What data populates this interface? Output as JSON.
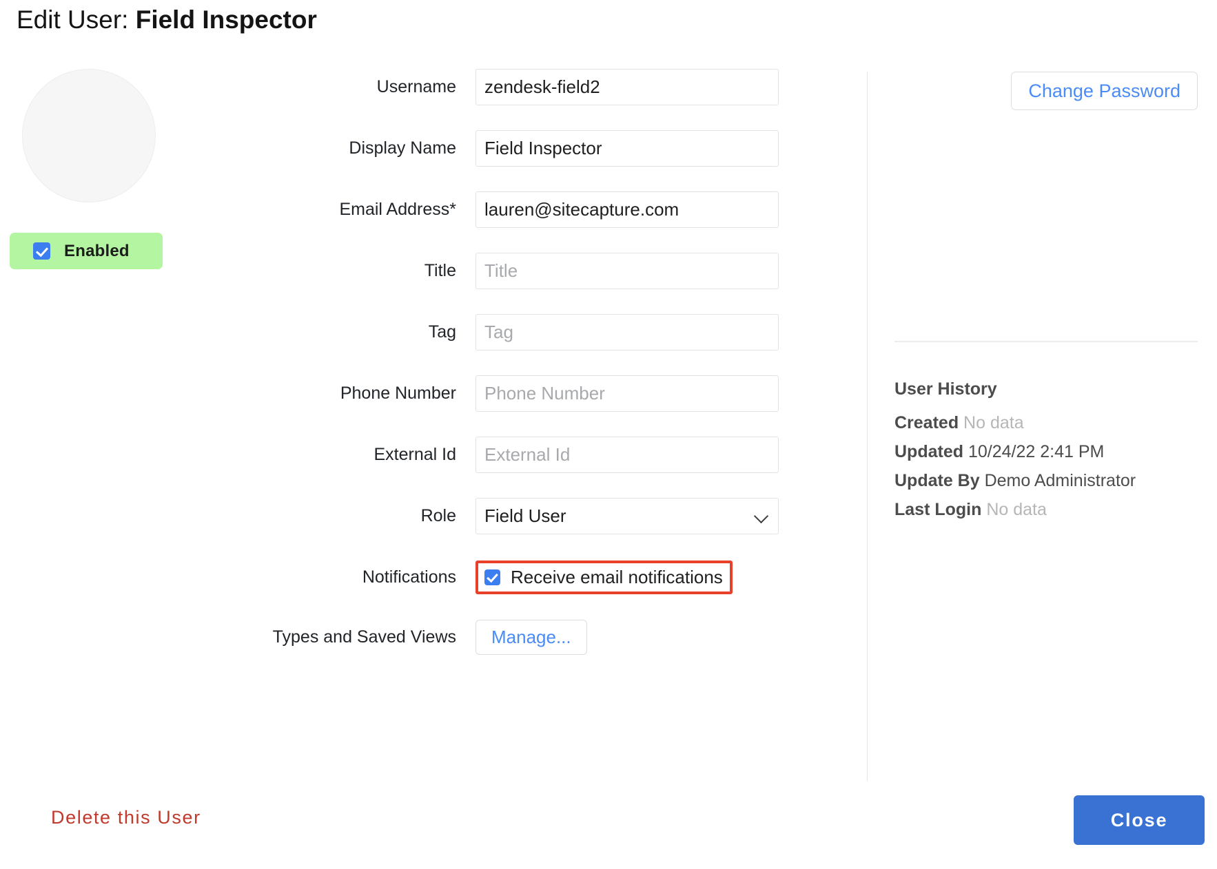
{
  "header": {
    "title_prefix": "Edit User: ",
    "user_name": "Field Inspector"
  },
  "profile": {
    "avatar_alt": "user-avatar-placeholder",
    "enabled_label": "Enabled",
    "enabled_checked": true,
    "enabled_badge_color": "#b4f5a1"
  },
  "form": {
    "fields": [
      {
        "label": "Username",
        "value": "zendesk-field2",
        "placeholder": "Username"
      },
      {
        "label": "Display Name",
        "value": "Field Inspector",
        "placeholder": "Display Name"
      },
      {
        "label": "Email Address*",
        "value": "lauren@sitecapture.com",
        "placeholder": "Email Address"
      },
      {
        "label": "Title",
        "value": "",
        "placeholder": "Title"
      },
      {
        "label": "Tag",
        "value": "",
        "placeholder": "Tag"
      },
      {
        "label": "Phone Number",
        "value": "",
        "placeholder": "Phone Number"
      },
      {
        "label": "External Id",
        "value": "",
        "placeholder": "External Id"
      }
    ],
    "role": {
      "label": "Role",
      "value": "Field User",
      "chevron_icon": "chevron-down-icon"
    },
    "notifications": {
      "label": "Notifications",
      "checkbox_label": "Receive email notifications",
      "checked": true,
      "highlight_color": "#e8402a"
    },
    "types_views": {
      "label": "Types and Saved Views",
      "button_label": "Manage..."
    }
  },
  "side_panel": {
    "change_password_label": "Change Password",
    "history_title": "User History",
    "history": [
      {
        "label": "Created",
        "value": "No data",
        "no_data": true
      },
      {
        "label": "Updated",
        "value": "10/24/22 2:41 PM",
        "no_data": false
      },
      {
        "label": "Update By",
        "value": "Demo Administrator",
        "no_data": false
      },
      {
        "label": "Last Login",
        "value": "No data",
        "no_data": true
      }
    ]
  },
  "footer": {
    "delete_label": "Delete this User",
    "close_label": "Close",
    "delete_color": "#c0392b",
    "close_color": "#3a72d4"
  }
}
